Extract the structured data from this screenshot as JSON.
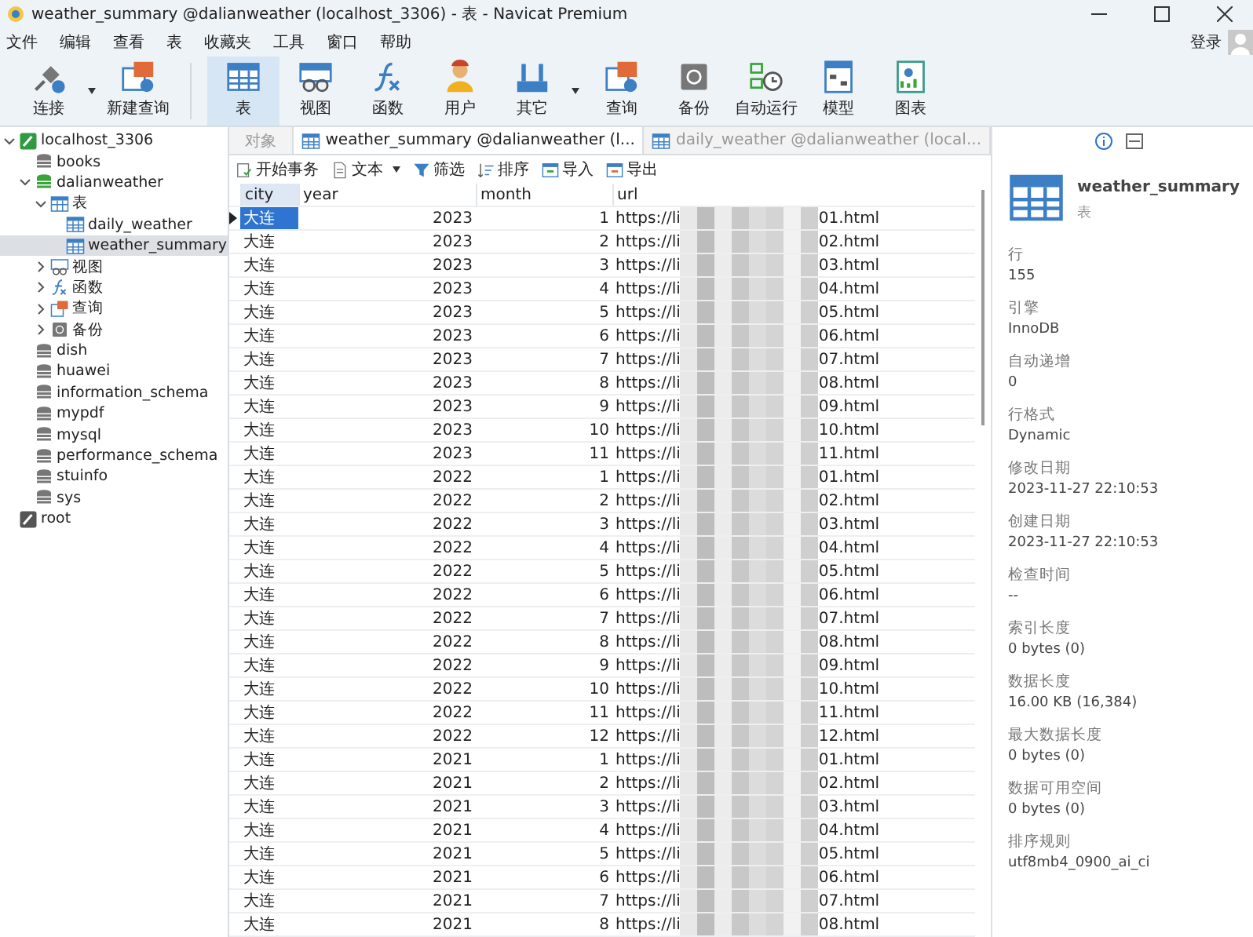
{
  "window": {
    "title": "weather_summary @dalianweather (localhost_3306) - 表 - Navicat Premium"
  },
  "menu": [
    "文件",
    "编辑",
    "查看",
    "表",
    "收藏夹",
    "工具",
    "窗口",
    "帮助"
  ],
  "login": "登录",
  "toolbar": [
    {
      "label": "连接",
      "kind": "plug",
      "dropdown": true,
      "selected": false
    },
    {
      "label": "新建查询",
      "kind": "query",
      "dropdown": false,
      "selected": false
    },
    {
      "label": "表",
      "kind": "table",
      "dropdown": false,
      "selected": true
    },
    {
      "label": "视图",
      "kind": "view",
      "dropdown": false,
      "selected": false
    },
    {
      "label": "函数",
      "kind": "function",
      "dropdown": false,
      "selected": false
    },
    {
      "label": "用户",
      "kind": "user",
      "dropdown": false,
      "selected": false
    },
    {
      "label": "其它",
      "kind": "tools",
      "dropdown": true,
      "selected": false
    },
    {
      "label": "查询",
      "kind": "query",
      "dropdown": false,
      "selected": false
    },
    {
      "label": "备份",
      "kind": "backup",
      "dropdown": false,
      "selected": false
    },
    {
      "label": "自动运行",
      "kind": "schedule",
      "dropdown": false,
      "selected": false
    },
    {
      "label": "模型",
      "kind": "model",
      "dropdown": false,
      "selected": false
    },
    {
      "label": "图表",
      "kind": "chart",
      "dropdown": false,
      "selected": false
    }
  ],
  "sidebar": {
    "items": [
      {
        "label": "localhost_3306",
        "kind": "server",
        "expanded": true,
        "selected": false,
        "children": [
          {
            "label": "books",
            "kind": "database",
            "selected": false
          },
          {
            "label": "dalianweather",
            "kind": "database-open",
            "expanded": true,
            "selected": false,
            "children": [
              {
                "label": "表",
                "kind": "tables",
                "expanded": true,
                "selected": false,
                "children": [
                  {
                    "label": "daily_weather",
                    "kind": "table",
                    "selected": false
                  },
                  {
                    "label": "weather_summary",
                    "kind": "table",
                    "selected": true
                  }
                ]
              },
              {
                "label": "视图",
                "kind": "views",
                "expanded": false,
                "selected": false
              },
              {
                "label": "函数",
                "kind": "functions",
                "expanded": false,
                "selected": false
              },
              {
                "label": "查询",
                "kind": "queries",
                "expanded": false,
                "selected": false
              },
              {
                "label": "备份",
                "kind": "backups",
                "expanded": false,
                "selected": false
              }
            ]
          },
          {
            "label": "dish",
            "kind": "database",
            "selected": false
          },
          {
            "label": "huawei",
            "kind": "database",
            "selected": false
          },
          {
            "label": "information_schema",
            "kind": "database",
            "selected": false
          },
          {
            "label": "mypdf",
            "kind": "database",
            "selected": false
          },
          {
            "label": "mysql",
            "kind": "database",
            "selected": false
          },
          {
            "label": "performance_schema",
            "kind": "database",
            "selected": false
          },
          {
            "label": "stuinfo",
            "kind": "database",
            "selected": false
          },
          {
            "label": "sys",
            "kind": "database",
            "selected": false
          }
        ]
      },
      {
        "label": "root",
        "kind": "server-off",
        "selected": false
      }
    ]
  },
  "tabs": [
    {
      "label": "对象",
      "kind": "objects",
      "selected": false
    },
    {
      "label": "weather_summary @dalianweather (l...",
      "kind": "table",
      "selected": true
    },
    {
      "label": "daily_weather @dalianweather (local...",
      "kind": "table",
      "selected": false
    }
  ],
  "actions": [
    {
      "label": "开始事务",
      "kind": "transaction",
      "dropdown": false
    },
    {
      "label": "文本",
      "kind": "text",
      "dropdown": true
    },
    {
      "label": "筛选",
      "kind": "filter",
      "dropdown": false
    },
    {
      "label": "排序",
      "kind": "sort",
      "dropdown": false
    },
    {
      "label": "导入",
      "kind": "import",
      "dropdown": false
    },
    {
      "label": "导出",
      "kind": "export",
      "dropdown": false
    }
  ],
  "table": {
    "columns": [
      "city",
      "year",
      "month",
      "url"
    ],
    "rows": [
      {
        "city": "大连",
        "year": "2023",
        "month": "1",
        "url_start": "https://li",
        "url_end": "01.html",
        "selected": true
      },
      {
        "city": "大连",
        "year": "2023",
        "month": "2",
        "url_start": "https://li",
        "url_end": "02.html",
        "selected": false
      },
      {
        "city": "大连",
        "year": "2023",
        "month": "3",
        "url_start": "https://li",
        "url_end": "03.html",
        "selected": false
      },
      {
        "city": "大连",
        "year": "2023",
        "month": "4",
        "url_start": "https://li",
        "url_end": "04.html",
        "selected": false
      },
      {
        "city": "大连",
        "year": "2023",
        "month": "5",
        "url_start": "https://li",
        "url_end": "05.html",
        "selected": false
      },
      {
        "city": "大连",
        "year": "2023",
        "month": "6",
        "url_start": "https://li",
        "url_end": "06.html",
        "selected": false
      },
      {
        "city": "大连",
        "year": "2023",
        "month": "7",
        "url_start": "https://li",
        "url_end": "07.html",
        "selected": false
      },
      {
        "city": "大连",
        "year": "2023",
        "month": "8",
        "url_start": "https://li",
        "url_end": "08.html",
        "selected": false
      },
      {
        "city": "大连",
        "year": "2023",
        "month": "9",
        "url_start": "https://li",
        "url_end": "09.html",
        "selected": false
      },
      {
        "city": "大连",
        "year": "2023",
        "month": "10",
        "url_start": "https://li",
        "url_end": "10.html",
        "selected": false
      },
      {
        "city": "大连",
        "year": "2023",
        "month": "11",
        "url_start": "https://li",
        "url_end": "11.html",
        "selected": false
      },
      {
        "city": "大连",
        "year": "2022",
        "month": "1",
        "url_start": "https://li",
        "url_end": "01.html",
        "selected": false
      },
      {
        "city": "大连",
        "year": "2022",
        "month": "2",
        "url_start": "https://li",
        "url_end": "02.html",
        "selected": false
      },
      {
        "city": "大连",
        "year": "2022",
        "month": "3",
        "url_start": "https://li",
        "url_end": "03.html",
        "selected": false
      },
      {
        "city": "大连",
        "year": "2022",
        "month": "4",
        "url_start": "https://li",
        "url_end": "04.html",
        "selected": false
      },
      {
        "city": "大连",
        "year": "2022",
        "month": "5",
        "url_start": "https://li",
        "url_end": "05.html",
        "selected": false
      },
      {
        "city": "大连",
        "year": "2022",
        "month": "6",
        "url_start": "https://li",
        "url_end": "06.html",
        "selected": false
      },
      {
        "city": "大连",
        "year": "2022",
        "month": "7",
        "url_start": "https://li",
        "url_end": "07.html",
        "selected": false
      },
      {
        "city": "大连",
        "year": "2022",
        "month": "8",
        "url_start": "https://li",
        "url_end": "08.html",
        "selected": false
      },
      {
        "city": "大连",
        "year": "2022",
        "month": "9",
        "url_start": "https://li",
        "url_end": "09.html",
        "selected": false
      },
      {
        "city": "大连",
        "year": "2022",
        "month": "10",
        "url_start": "https://li",
        "url_end": "10.html",
        "selected": false
      },
      {
        "city": "大连",
        "year": "2022",
        "month": "11",
        "url_start": "https://li",
        "url_end": "11.html",
        "selected": false
      },
      {
        "city": "大连",
        "year": "2022",
        "month": "12",
        "url_start": "https://li",
        "url_end": "12.html",
        "selected": false
      },
      {
        "city": "大连",
        "year": "2021",
        "month": "1",
        "url_start": "https://li",
        "url_end": "01.html",
        "selected": false
      },
      {
        "city": "大连",
        "year": "2021",
        "month": "2",
        "url_start": "https://li",
        "url_end": "02.html",
        "selected": false
      },
      {
        "city": "大连",
        "year": "2021",
        "month": "3",
        "url_start": "https://li",
        "url_end": "03.html",
        "selected": false
      },
      {
        "city": "大连",
        "year": "2021",
        "month": "4",
        "url_start": "https://li",
        "url_end": "04.html",
        "selected": false
      },
      {
        "city": "大连",
        "year": "2021",
        "month": "5",
        "url_start": "https://li",
        "url_end": "05.html",
        "selected": false
      },
      {
        "city": "大连",
        "year": "2021",
        "month": "6",
        "url_start": "https://li",
        "url_end": "06.html",
        "selected": false
      },
      {
        "city": "大连",
        "year": "2021",
        "month": "7",
        "url_start": "https://li",
        "url_end": "07.html",
        "selected": false
      },
      {
        "city": "大连",
        "year": "2021",
        "month": "8",
        "url_start": "https://li",
        "url_end": "08.html",
        "selected": false
      }
    ]
  },
  "info_panel": {
    "name": "weather_summary",
    "type": "表",
    "properties": [
      {
        "label": "行",
        "value": "155"
      },
      {
        "label": "引擎",
        "value": "InnoDB"
      },
      {
        "label": "自动递增",
        "value": "0"
      },
      {
        "label": "行格式",
        "value": "Dynamic"
      },
      {
        "label": "修改日期",
        "value": "2023-11-27 22:10:53"
      },
      {
        "label": "创建日期",
        "value": "2023-11-27 22:10:53"
      },
      {
        "label": "检查时间",
        "value": "--"
      },
      {
        "label": "索引长度",
        "value": "0 bytes (0)"
      },
      {
        "label": "数据长度",
        "value": "16.00 KB (16,384)"
      },
      {
        "label": "最大数据长度",
        "value": "0 bytes (0)"
      },
      {
        "label": "数据可用空间",
        "value": "0 bytes (0)"
      },
      {
        "label": "排序规则",
        "value": "utf8mb4_0900_ai_ci"
      }
    ]
  }
}
